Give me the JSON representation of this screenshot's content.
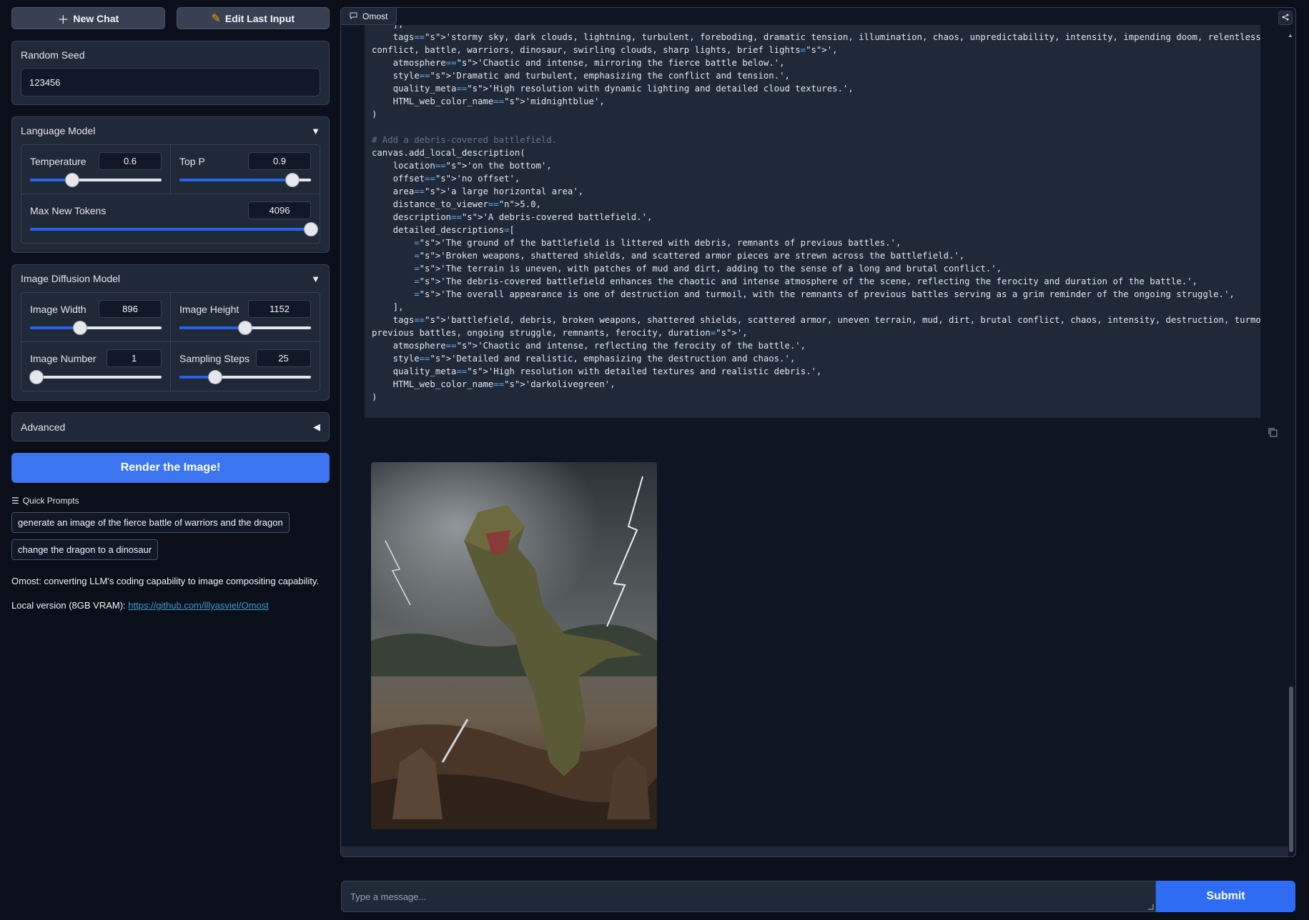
{
  "toolbar": {
    "new_chat_label": "New Chat",
    "edit_last_input_label": "Edit Last Input"
  },
  "seed": {
    "label": "Random Seed",
    "value": "123456"
  },
  "language_model": {
    "title": "Language Model",
    "temperature": {
      "label": "Temperature",
      "value": "0.6",
      "fraction": 0.32
    },
    "top_p": {
      "label": "Top P",
      "value": "0.9",
      "fraction": 0.86
    },
    "max_new_tokens": {
      "label": "Max New Tokens",
      "value": "4096",
      "fraction": 1.0
    }
  },
  "diffusion_model": {
    "title": "Image Diffusion Model",
    "image_width": {
      "label": "Image Width",
      "value": "896",
      "fraction": 0.38
    },
    "image_height": {
      "label": "Image Height",
      "value": "1152",
      "fraction": 0.5
    },
    "image_number": {
      "label": "Image Number",
      "value": "1",
      "fraction": 0.05
    },
    "sampling_steps": {
      "label": "Sampling Steps",
      "value": "25",
      "fraction": 0.27
    }
  },
  "advanced": {
    "title": "Advanced"
  },
  "render_button": "Render the Image!",
  "quick_prompts": {
    "title": "Quick Prompts",
    "items": [
      "generate an image of the fierce battle of warriors and the dragon",
      "change the dragon to a dinosaur"
    ]
  },
  "footer": {
    "tagline": "Omost: converting LLM's coding capability to image compositing capability.",
    "local_prefix": "Local version (8GB VRAM): ",
    "local_link": "https://github.com/lllyasviel/Omost"
  },
  "chat": {
    "tab_label": "Omost",
    "code_lines": [
      "    ],",
      "    tags='stormy sky, dark clouds, lightning, turbulent, foreboding, dramatic tension, illumination, chaos, unpredictability, intensity, impending doom, relentless",
      "conflict, battle, warriors, dinosaur, swirling clouds, sharp lights, brief lights',",
      "    atmosphere='Chaotic and intense, mirroring the fierce battle below.',",
      "    style='Dramatic and turbulent, emphasizing the conflict and tension.',",
      "    quality_meta='High resolution with dynamic lighting and detailed cloud textures.',",
      "    HTML_web_color_name='midnightblue',",
      ")",
      "",
      "# Add a debris-covered battlefield.",
      "canvas.add_local_description(",
      "    location='on the bottom',",
      "    offset='no offset',",
      "    area='a large horizontal area',",
      "    distance_to_viewer=5.0,",
      "    description='A debris-covered battlefield.',",
      "    detailed_descriptions=[",
      "        'The ground of the battlefield is littered with debris, remnants of previous battles.',",
      "        'Broken weapons, shattered shields, and scattered armor pieces are strewn across the battlefield.',",
      "        'The terrain is uneven, with patches of mud and dirt, adding to the sense of a long and brutal conflict.',",
      "        'The debris-covered battlefield enhances the chaotic and intense atmosphere of the scene, reflecting the ferocity and duration of the battle.',",
      "        'The overall appearance is one of destruction and turmoil, with the remnants of previous battles serving as a grim reminder of the ongoing struggle.',",
      "    ],",
      "    tags='battlefield, debris, broken weapons, shattered shields, scattered armor, uneven terrain, mud, dirt, brutal conflict, chaos, intensity, destruction, turmoil,",
      "previous battles, ongoing struggle, remnants, ferocity, duration',",
      "    atmosphere='Chaotic and intense, reflecting the ferocity of the battle.',",
      "    style='Detailed and realistic, emphasizing the destruction and chaos.',",
      "    quality_meta='High resolution with detailed textures and realistic debris.',",
      "    HTML_web_color_name='darkolivegreen',",
      ")"
    ]
  },
  "message_input": {
    "placeholder": "Type a message..."
  },
  "submit_label": "Submit",
  "colors": {
    "accent": "#3b76f0",
    "string": "#98c379",
    "number": "#d19a66",
    "comment": "#6b7280"
  }
}
